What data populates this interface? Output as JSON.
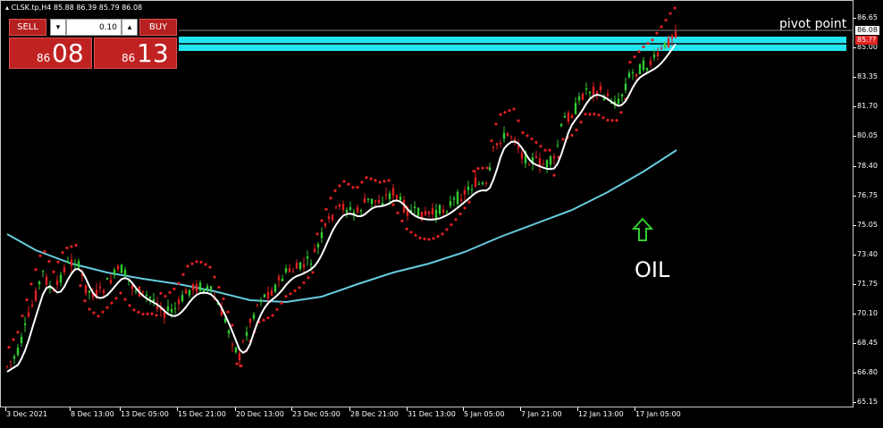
{
  "symbol_bar": {
    "text": "CLSK.tp,H4  85.88 86.39 85.79 86.08"
  },
  "trade_panel": {
    "sell_label": "SELL",
    "buy_label": "BUY",
    "lot_value": "0.10",
    "lot_down": "▾",
    "lot_up": "▴",
    "bid_small": "86",
    "bid_big": "08",
    "ask_small": "86",
    "ask_big": "13"
  },
  "annotations": {
    "pivot_label": "pivot point",
    "oil_label": "OIL"
  },
  "price_axis": {
    "ticks": [
      "86.65",
      "85.00",
      "83.35",
      "81.70",
      "80.05",
      "78.40",
      "76.75",
      "75.05",
      "73.40",
      "71.75",
      "70.10",
      "68.45",
      "66.80",
      "65.15"
    ],
    "current_price": "86.08",
    "zone_price": "85.??"
  },
  "time_axis": {
    "ticks": [
      "3 Dec 2021",
      "8 Dec 13:00",
      "13 Dec 05:00",
      "15 Dec 21:00",
      "20 Dec 13:00",
      "23 Dec 05:00",
      "28 Dec 21:00",
      "31 Dec 13:00",
      "5 Jan 05:00",
      "7 Jan 21:00",
      "12 Jan 13:00",
      "17 Jan 05:00"
    ]
  },
  "colors": {
    "background": "#000000",
    "bull_candle": "#33cc33",
    "bear_candle": "#e02020",
    "fast_ma": "#ffffff",
    "slow_ma": "#66ccdd",
    "sar_dots": "#e02020",
    "pivot_zone": "#22e5f0",
    "button_red": "#b52020"
  }
}
